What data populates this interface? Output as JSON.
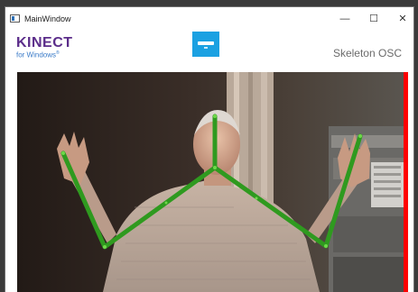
{
  "window": {
    "title": "MainWindow",
    "minimize_glyph": "—",
    "maximize_glyph": "☐",
    "close_glyph": "✕"
  },
  "header": {
    "logo_main": "KINECT",
    "logo_sub": "for Windows",
    "logo_sub_mark": "®",
    "app_title": "Skeleton OSC",
    "sensor_icon": "kinect-sensor-icon"
  },
  "colors": {
    "skeleton": "#2f9a1f",
    "joint": "#6fd84a",
    "status_bar": "#ff0000",
    "logo": "#5b2d8a",
    "sensor_tile": "#1ba1e2"
  }
}
